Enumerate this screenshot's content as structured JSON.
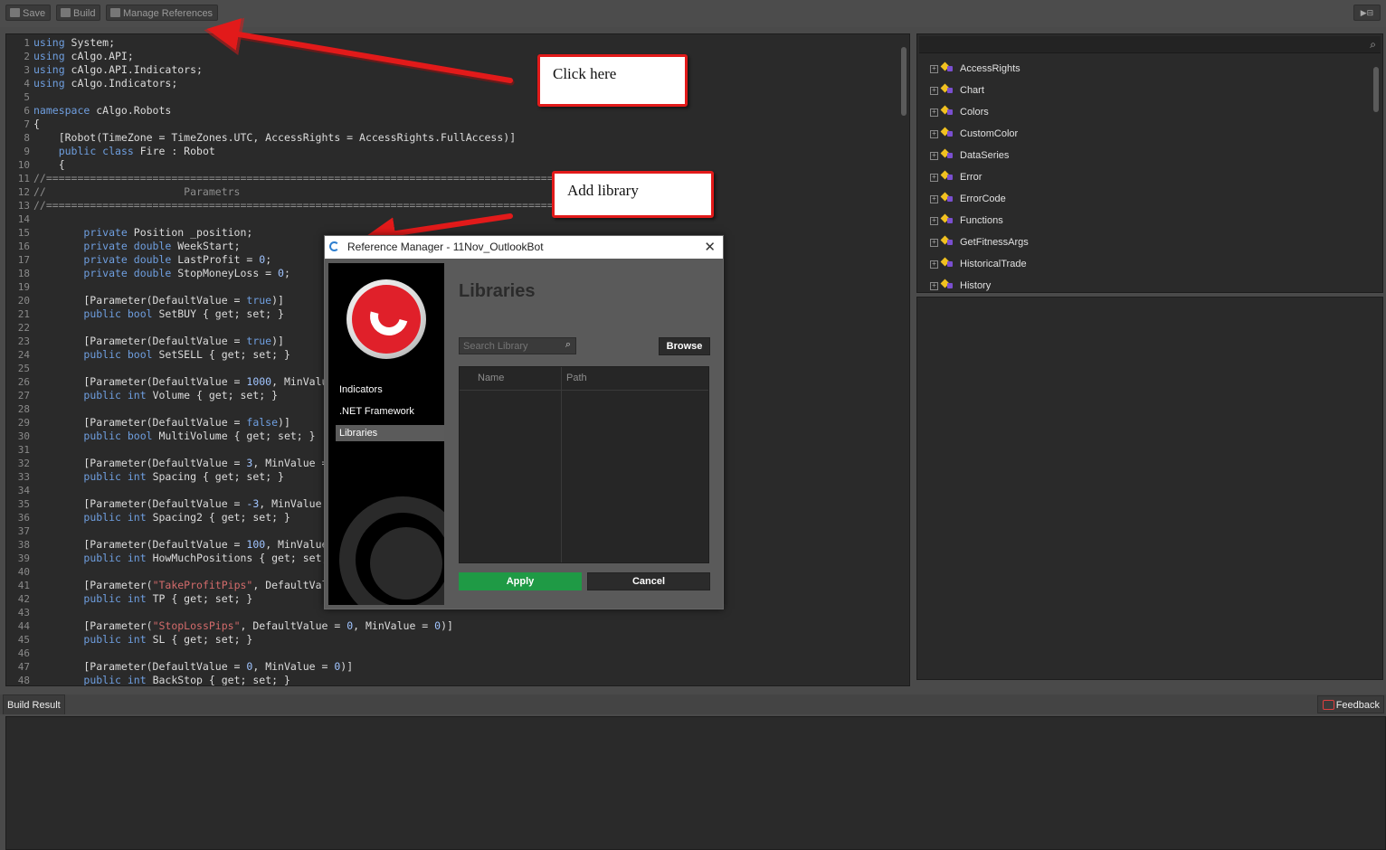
{
  "toolbar": {
    "save_label": "Save",
    "build_label": "Build",
    "manage_references_label": "Manage References"
  },
  "editor": {
    "lines": [
      [
        [
          "kw",
          "using"
        ],
        [
          "t",
          " System;"
        ]
      ],
      [
        [
          "kw",
          "using"
        ],
        [
          "t",
          " cAlgo.API;"
        ]
      ],
      [
        [
          "kw",
          "using"
        ],
        [
          "t",
          " cAlgo.API.Indicators;"
        ]
      ],
      [
        [
          "kw",
          "using"
        ],
        [
          "t",
          " cAlgo.Indicators;"
        ]
      ],
      [],
      [
        [
          "kw",
          "namespace"
        ],
        [
          "t",
          " cAlgo.Robots"
        ]
      ],
      [
        [
          "t",
          "{"
        ]
      ],
      [
        [
          "t",
          "    [Robot(TimeZone = TimeZones.UTC, AccessRights = AccessRights.FullAccess)]"
        ]
      ],
      [
        [
          "t",
          "    "
        ],
        [
          "kw",
          "public class"
        ],
        [
          "t",
          " Fire : Robot"
        ]
      ],
      [
        [
          "t",
          "    {"
        ]
      ],
      [
        [
          "cm",
          "//=========================================================================================="
        ]
      ],
      [
        [
          "cm",
          "//                      Parametrs"
        ]
      ],
      [
        [
          "cm",
          "//=========================================================================================="
        ]
      ],
      [],
      [
        [
          "t",
          "        "
        ],
        [
          "kw",
          "private"
        ],
        [
          "t",
          " Position _position;"
        ]
      ],
      [
        [
          "t",
          "        "
        ],
        [
          "kw",
          "private double"
        ],
        [
          "t",
          " WeekStart;"
        ]
      ],
      [
        [
          "t",
          "        "
        ],
        [
          "kw",
          "private double"
        ],
        [
          "t",
          " LastProfit = "
        ],
        [
          "num",
          "0"
        ],
        [
          "t",
          ";"
        ]
      ],
      [
        [
          "t",
          "        "
        ],
        [
          "kw",
          "private double"
        ],
        [
          "t",
          " StopMoneyLoss = "
        ],
        [
          "num",
          "0"
        ],
        [
          "t",
          ";"
        ]
      ],
      [],
      [
        [
          "t",
          "        [Parameter(DefaultValue = "
        ],
        [
          "kw",
          "true"
        ],
        [
          "t",
          ")]"
        ]
      ],
      [
        [
          "t",
          "        "
        ],
        [
          "kw",
          "public bool"
        ],
        [
          "t",
          " SetBUY { get; set; }"
        ]
      ],
      [],
      [
        [
          "t",
          "        [Parameter(DefaultValue = "
        ],
        [
          "kw",
          "true"
        ],
        [
          "t",
          ")]"
        ]
      ],
      [
        [
          "t",
          "        "
        ],
        [
          "kw",
          "public bool"
        ],
        [
          "t",
          " SetSELL { get; set; }"
        ]
      ],
      [],
      [
        [
          "t",
          "        [Parameter(DefaultValue = "
        ],
        [
          "num",
          "1000"
        ],
        [
          "t",
          ", MinValue = 1000)]"
        ]
      ],
      [
        [
          "t",
          "        "
        ],
        [
          "kw",
          "public int"
        ],
        [
          "t",
          " Volume { get; set; }"
        ]
      ],
      [],
      [
        [
          "t",
          "        [Parameter(DefaultValue = "
        ],
        [
          "kw",
          "false"
        ],
        [
          "t",
          ")]"
        ]
      ],
      [
        [
          "t",
          "        "
        ],
        [
          "kw",
          "public bool"
        ],
        [
          "t",
          " MultiVolume { get; set; }"
        ]
      ],
      [],
      [
        [
          "t",
          "        [Parameter(DefaultValue = "
        ],
        [
          "num",
          "3"
        ],
        [
          "t",
          ", MinValue = 1)]"
        ]
      ],
      [
        [
          "t",
          "        "
        ],
        [
          "kw",
          "public int"
        ],
        [
          "t",
          " Spacing { get; set; }"
        ]
      ],
      [],
      [
        [
          "t",
          "        [Parameter(DefaultValue = "
        ],
        [
          "num",
          "-3"
        ],
        [
          "t",
          ", MinValue = -100)]"
        ]
      ],
      [
        [
          "t",
          "        "
        ],
        [
          "kw",
          "public int"
        ],
        [
          "t",
          " Spacing2 { get; set; }"
        ]
      ],
      [],
      [
        [
          "t",
          "        [Parameter(DefaultValue = "
        ],
        [
          "num",
          "100"
        ],
        [
          "t",
          ", MinValue = 1)]"
        ]
      ],
      [
        [
          "t",
          "        "
        ],
        [
          "kw",
          "public int"
        ],
        [
          "t",
          " HowMuchPositions { get; set; }"
        ]
      ],
      [],
      [
        [
          "t",
          "        [Parameter("
        ],
        [
          "str",
          "\"TakeProfitPips\""
        ],
        [
          "t",
          ", DefaultValue = 0, MinValue = 0)]"
        ]
      ],
      [
        [
          "t",
          "        "
        ],
        [
          "kw",
          "public int"
        ],
        [
          "t",
          " TP { get; set; }"
        ]
      ],
      [],
      [
        [
          "t",
          "        [Parameter("
        ],
        [
          "str",
          "\"StopLossPips\""
        ],
        [
          "t",
          ", DefaultValue = "
        ],
        [
          "num",
          "0"
        ],
        [
          "t",
          ", MinValue = "
        ],
        [
          "num",
          "0"
        ],
        [
          "t",
          ")]"
        ]
      ],
      [
        [
          "t",
          "        "
        ],
        [
          "kw",
          "public int"
        ],
        [
          "t",
          " SL { get; set; }"
        ]
      ],
      [],
      [
        [
          "t",
          "        [Parameter(DefaultValue = "
        ],
        [
          "num",
          "0"
        ],
        [
          "t",
          ", MinValue = "
        ],
        [
          "num",
          "0"
        ],
        [
          "t",
          ")]"
        ]
      ],
      [
        [
          "t",
          "        "
        ],
        [
          "kw",
          "public int"
        ],
        [
          "t",
          " BackStop { get; set; }"
        ]
      ]
    ]
  },
  "tree": {
    "items": [
      "AccessRights",
      "Chart",
      "Colors",
      "CustomColor",
      "DataSeries",
      "Error",
      "ErrorCode",
      "Functions",
      "GetFitnessArgs",
      "HistoricalTrade",
      "History"
    ]
  },
  "bottom": {
    "build_result_tab": "Build Result",
    "feedback_label": "Feedback"
  },
  "callouts": {
    "click_here": "Click here",
    "add_library": "Add library"
  },
  "dialog": {
    "title": "Reference Manager - 11Nov_OutlookBot",
    "nav": [
      "Indicators",
      ".NET Framework",
      "Libraries"
    ],
    "heading": "Libraries",
    "search_placeholder": "Search Library",
    "browse_label": "Browse",
    "col_name": "Name",
    "col_path": "Path",
    "apply_label": "Apply",
    "cancel_label": "Cancel"
  },
  "colors": {
    "accent_apply": "#1f9a45",
    "callout_border": "#e21a1a"
  }
}
